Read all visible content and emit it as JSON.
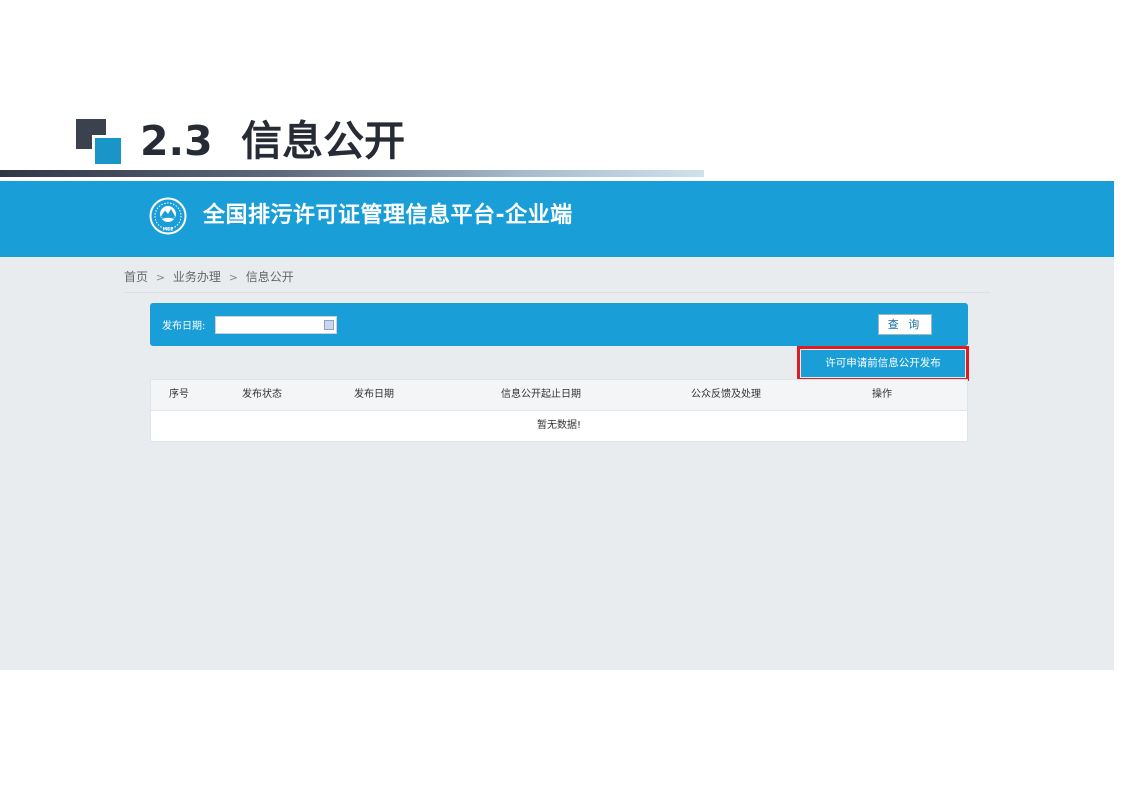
{
  "slide": {
    "title": "2.3  信息公开"
  },
  "banner": {
    "title": "全国排污许可证管理信息平台-企业端",
    "logo_text": "MEE"
  },
  "breadcrumb": {
    "home": "首页",
    "sep": ">",
    "level2": "业务办理",
    "level3": "信息公开"
  },
  "search": {
    "label": "发布日期:",
    "date_value": "",
    "query_button": "查 询"
  },
  "publish_button": "许可申请前信息公开发布",
  "table": {
    "columns": [
      "序号",
      "发布状态",
      "发布日期",
      "信息公开起止日期",
      "公众反馈及处理",
      "操作"
    ],
    "empty_text": "暂无数据!"
  },
  "colors": {
    "brand_blue": "#1a9ed8",
    "highlight_red": "#e11b22",
    "page_bg": "#e9ecef"
  },
  "icons": {
    "logo": "mee-emblem-icon",
    "calendar": "calendar-icon"
  }
}
